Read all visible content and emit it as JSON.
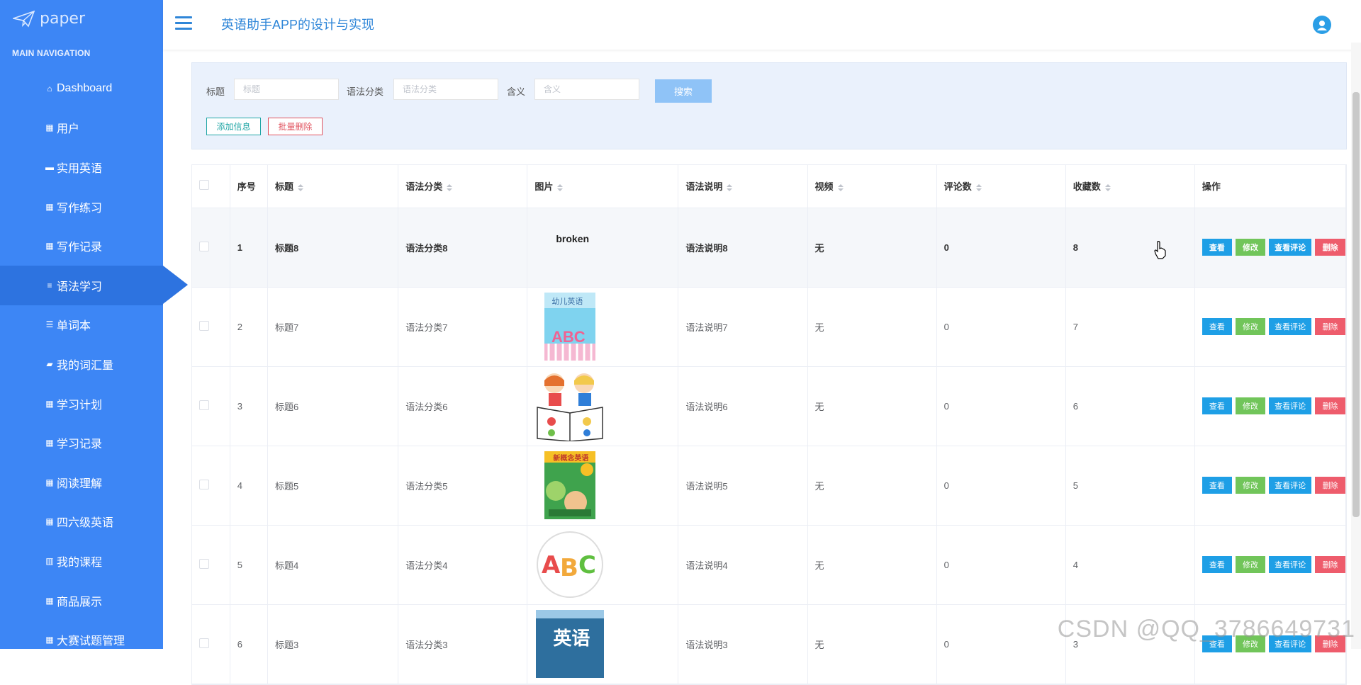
{
  "app": {
    "logo_text": "paper",
    "title": "英语助手APP的设计与实现"
  },
  "sidebar": {
    "section_label": "MAIN NAVIGATION",
    "items": [
      {
        "label": "Dashboard",
        "icon": "home-icon",
        "glyph": "⌂"
      },
      {
        "label": "用户",
        "icon": "grid-icon",
        "glyph": "▦"
      },
      {
        "label": "实用英语",
        "icon": "briefcase-icon",
        "glyph": "▬"
      },
      {
        "label": "写作练习",
        "icon": "grid-icon",
        "glyph": "▦"
      },
      {
        "label": "写作记录",
        "icon": "grid-icon",
        "glyph": "▦"
      },
      {
        "label": "语法学习",
        "icon": "list-icon",
        "glyph": "≡",
        "active": true
      },
      {
        "label": "单词本",
        "icon": "sliders-icon",
        "glyph": "☰"
      },
      {
        "label": "我的词汇量",
        "icon": "ticket-icon",
        "glyph": "▰"
      },
      {
        "label": "学习计划",
        "icon": "grid-icon",
        "glyph": "▦"
      },
      {
        "label": "学习记录",
        "icon": "grid-icon",
        "glyph": "▦"
      },
      {
        "label": "阅读理解",
        "icon": "grid-icon",
        "glyph": "▦"
      },
      {
        "label": "四六级英语",
        "icon": "grid-icon",
        "glyph": "▦"
      },
      {
        "label": "我的课程",
        "icon": "bar-chart-icon",
        "glyph": "▥"
      },
      {
        "label": "商品展示",
        "icon": "grid-icon",
        "glyph": "▦"
      },
      {
        "label": "大赛试题管理",
        "icon": "grid-icon",
        "glyph": "▦"
      }
    ]
  },
  "search": {
    "title_label": "标题",
    "title_placeholder": "标题",
    "category_label": "语法分类",
    "category_placeholder": "语法分类",
    "meaning_label": "含义",
    "meaning_placeholder": "含义",
    "search_button": "搜索",
    "add_button": "添加信息",
    "batch_delete_button": "批量删除"
  },
  "table": {
    "headers": [
      "序号",
      "标题",
      "语法分类",
      "图片",
      "语法说明",
      "视频",
      "评论数",
      "收藏数",
      "操作"
    ],
    "actions": {
      "view": "查看",
      "edit": "修改",
      "review": "查看评论",
      "delete": "删除"
    },
    "broken_image_text": "broken",
    "rows": [
      {
        "index": "1",
        "title": "标题8",
        "category": "语法分类8",
        "image": "broken",
        "description": "语法说明8",
        "video": "无",
        "comments": "0",
        "favorites": "8"
      },
      {
        "index": "2",
        "title": "标题7",
        "category": "语法分类7",
        "image": "book-cover-abc",
        "book_text": "幼儿英语",
        "description": "语法说明7",
        "video": "无",
        "comments": "0",
        "favorites": "7"
      },
      {
        "index": "3",
        "title": "标题6",
        "category": "语法分类6",
        "image": "kids-reading",
        "description": "语法说明6",
        "video": "无",
        "comments": "0",
        "favorites": "6"
      },
      {
        "index": "4",
        "title": "标题5",
        "category": "语法分类5",
        "image": "book-cover-green",
        "book_text": "新概念英语",
        "description": "语法说明5",
        "video": "无",
        "comments": "0",
        "favorites": "5"
      },
      {
        "index": "5",
        "title": "标题4",
        "category": "语法分类4",
        "image": "abc-circle",
        "description": "语法说明4",
        "video": "无",
        "comments": "0",
        "favorites": "4"
      },
      {
        "index": "6",
        "title": "标题3",
        "category": "语法分类3",
        "image": "book-cover-blue",
        "book_text": "英语",
        "description": "语法说明3",
        "video": "无",
        "comments": "0",
        "favorites": "3"
      }
    ]
  },
  "watermark": "CSDN @QQ_3786649731"
}
